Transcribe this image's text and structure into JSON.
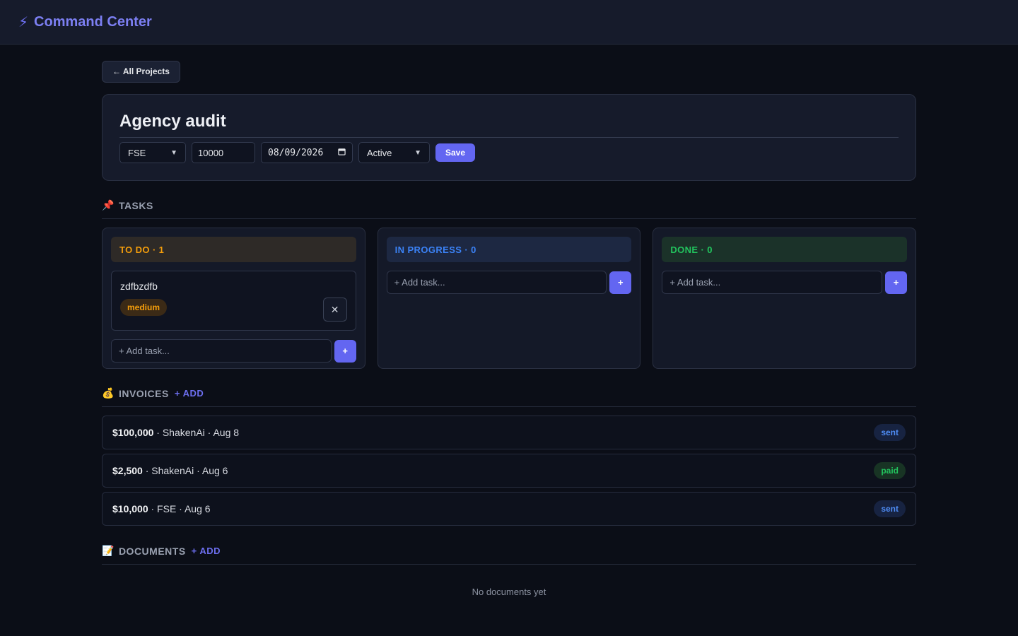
{
  "app": {
    "title": "Command Center",
    "icon": "bolt-icon"
  },
  "nav": {
    "back_label": "← All Projects"
  },
  "project": {
    "title": "Agency audit",
    "client": "FSE",
    "budget": "10000",
    "date": "08/09/2026",
    "status": "Active",
    "save_label": "Save"
  },
  "tasks": {
    "emoji": "📌",
    "heading": "TASKS",
    "add_placeholder": "+ Add task...",
    "add_button": "+",
    "columns": [
      {
        "label": "TO DO · 1"
      },
      {
        "label": "IN PROGRESS · 0"
      },
      {
        "label": "DONE · 0"
      }
    ],
    "items": [
      {
        "title": "zdfbzdfb",
        "priority": "medium",
        "delete": "✕"
      }
    ]
  },
  "invoices": {
    "emoji": "💰",
    "heading": "INVOICES",
    "add_label": "+ ADD",
    "rows": [
      {
        "amount": "$100,000",
        "details": "· ShakenAi · Aug 8",
        "status": "sent"
      },
      {
        "amount": "$2,500",
        "details": "· ShakenAi · Aug 6",
        "status": "paid"
      },
      {
        "amount": "$10,000",
        "details": "· FSE · Aug 6",
        "status": "sent"
      }
    ]
  },
  "documents": {
    "emoji": "📝",
    "heading": "DOCUMENTS",
    "add_label": "+ ADD",
    "empty_text": "No documents yet"
  },
  "colors": {
    "accent": "#6366f1",
    "todo": "#f59e0b",
    "in_progress": "#3b82f6",
    "done": "#22c55e"
  }
}
